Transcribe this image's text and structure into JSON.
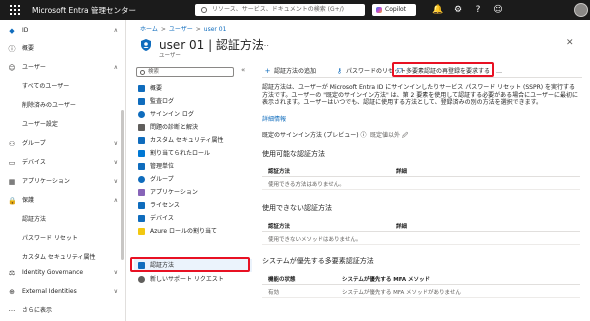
{
  "topbar": {
    "brand": "Microsoft Entra 管理センター",
    "search_placeholder": "リソース、サービス、ドキュメントの検索 (G+/)",
    "copilot_label": "Copilot"
  },
  "left_nav": {
    "items": [
      {
        "label": "ID",
        "icon": "diamond-icon",
        "chev": "∧"
      },
      {
        "label": "概要",
        "icon": "info-icon",
        "chev": ""
      },
      {
        "label": "ユーザー",
        "icon": "person-icon",
        "chev": "∧"
      },
      {
        "label": "すべてのユーザー",
        "icon": "",
        "chev": ""
      },
      {
        "label": "削除済みのユーザー",
        "icon": "",
        "chev": ""
      },
      {
        "label": "ユーザー設定",
        "icon": "",
        "chev": ""
      },
      {
        "label": "グループ",
        "icon": "group-icon",
        "chev": "∨"
      },
      {
        "label": "デバイス",
        "icon": "device-icon",
        "chev": "∨"
      },
      {
        "label": "アプリケーション",
        "icon": "apps-icon",
        "chev": "∨"
      },
      {
        "label": "保護",
        "icon": "lock-icon",
        "chev": "∧"
      },
      {
        "label": "認証方法",
        "icon": "",
        "chev": ""
      },
      {
        "label": "パスワード リセット",
        "icon": "",
        "chev": ""
      },
      {
        "label": "カスタム セキュリティ属性",
        "icon": "",
        "chev": ""
      },
      {
        "label": "Identity Governance",
        "icon": "governance-icon",
        "chev": "∨"
      },
      {
        "label": "External Identities",
        "icon": "external-icon",
        "chev": "∨"
      },
      {
        "label": "さらに表示",
        "icon": "more-icon",
        "chev": ""
      }
    ]
  },
  "breadcrumb": {
    "home": "ホーム",
    "sep": ">",
    "users": "ユーザー",
    "current": "user 01"
  },
  "header": {
    "title": "user 01 | 認証方法",
    "subtitle": "ユーザー",
    "more": "…",
    "close": "✕"
  },
  "resource_search": {
    "placeholder": "検索",
    "collapse": "«"
  },
  "resource_menu": {
    "items": [
      {
        "label": "概要",
        "color": "#0f6cbd"
      },
      {
        "label": "監査ログ",
        "color": "#0f6cbd"
      },
      {
        "label": "サインイン ログ",
        "color": "#0f6cbd"
      },
      {
        "label": "問題の診断と解決",
        "color": "#605e5c"
      },
      {
        "label": "カスタム セキュリティ属性",
        "color": "#0f6cbd"
      },
      {
        "label": "割り当てられたロール",
        "color": "#0078d4"
      },
      {
        "label": "管理単位",
        "color": "#0f6cbd"
      },
      {
        "label": "グループ",
        "color": "#0f6cbd"
      },
      {
        "label": "アプリケーション",
        "color": "#8764b8"
      },
      {
        "label": "ライセンス",
        "color": "#0f6cbd"
      },
      {
        "label": "デバイス",
        "color": "#0f6cbd"
      },
      {
        "label": "Azure ロールの割り当て",
        "color": "#f2c811"
      },
      {
        "label": "認証方法",
        "color": "#0f6cbd"
      },
      {
        "label": "新しいサポート リクエスト",
        "color": "#605e5c"
      }
    ],
    "active_index": 12
  },
  "toolbar": {
    "add": "認証方法の追加",
    "reset_password": "パスワードのリセット",
    "require_mfa": "多要素認証の再登録を要求する",
    "more": "…"
  },
  "description": "認証方法は、ユーザーが Microsoft Entra ID にサインインしたりサービス パスワード リセット (SSPR) を実行する方法です。ユーザーの \"既定のサインイン方法\" は、第 2 要素を使用して認証する必要がある場合にユーザーに最初に表示されます。ユーザーはいつでも、認証に使用する方法として、登録済みの別の方法を選択できます。",
  "description_link": "詳細情報",
  "preference": {
    "label": "既定のサインイン方法 (プレビュー) ⓘ",
    "value": "既定値以外 🖉"
  },
  "sections": {
    "usable": {
      "title": "使用可能な認証方法",
      "col1": "認証方法",
      "col2": "詳細",
      "empty": "使用できる方法はありません。"
    },
    "unusable": {
      "title": "使用できない認証方法",
      "col1": "認証方法",
      "col2": "詳細",
      "empty": "使用できないメソッドはありません。"
    },
    "system_preferred": {
      "title": "システムが優先する多要素認証方法",
      "col1": "機能の状態",
      "col2": "システムが優先する MFA メソッド",
      "state": "有効",
      "value": "システムが優先する MFA メソッドがありません"
    }
  }
}
